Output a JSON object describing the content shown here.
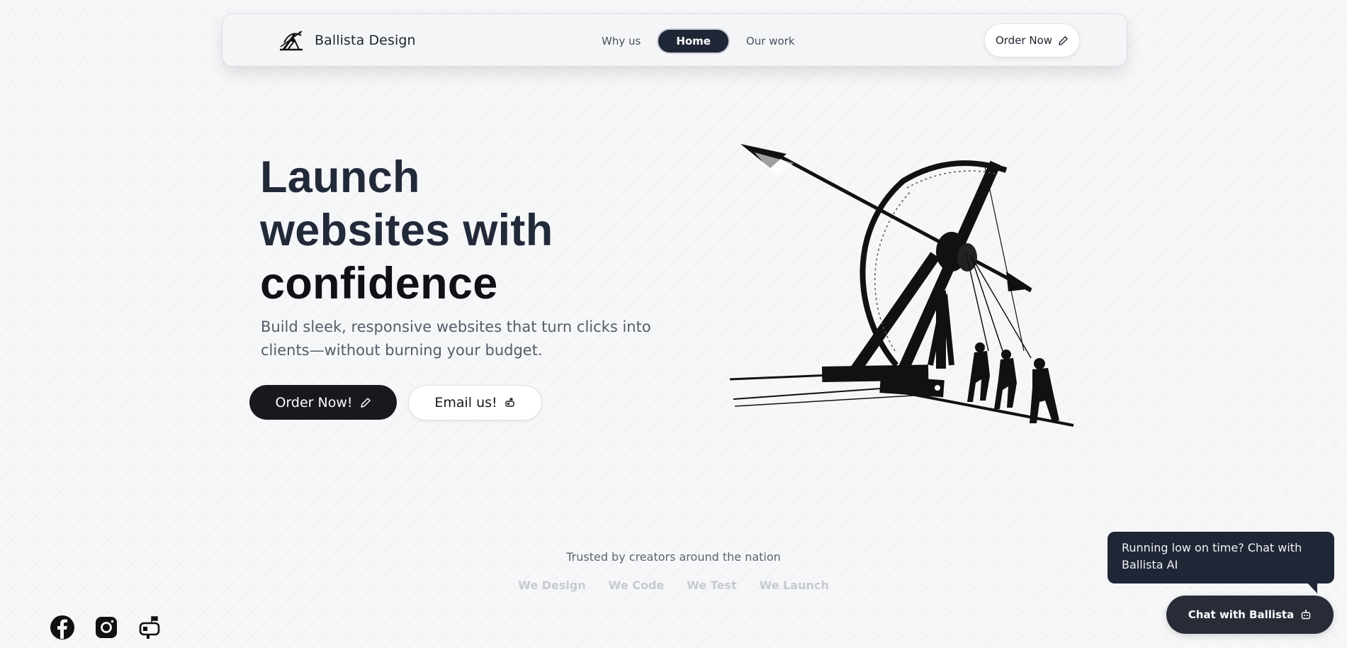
{
  "nav": {
    "brand": "Ballista Design",
    "links": [
      {
        "label": "Why us"
      },
      {
        "label": "Home"
      },
      {
        "label": "Our work"
      }
    ],
    "cta": "Order Now"
  },
  "hero": {
    "title_line1": "Launch",
    "title_line2": "websites with",
    "title_line3": "confidence",
    "subtitle": "Build sleek, responsive websites that turn clicks into clients—without burning your budget.",
    "primary_cta": "Order Now!",
    "secondary_cta": "Email us!"
  },
  "trust": {
    "heading": "Trusted by creators around the nation",
    "items": [
      "We Design",
      "We Code",
      "We Test",
      "We Launch"
    ]
  },
  "chat": {
    "bubble": "Running low on time? Chat with Ballista AI",
    "button": "Chat with Ballista"
  },
  "social": [
    "facebook-icon",
    "instagram-icon",
    "mailbox-icon"
  ],
  "colors": {
    "dark_navy": "#1f2636",
    "near_black": "#17191d",
    "muted_text": "#555b67"
  }
}
